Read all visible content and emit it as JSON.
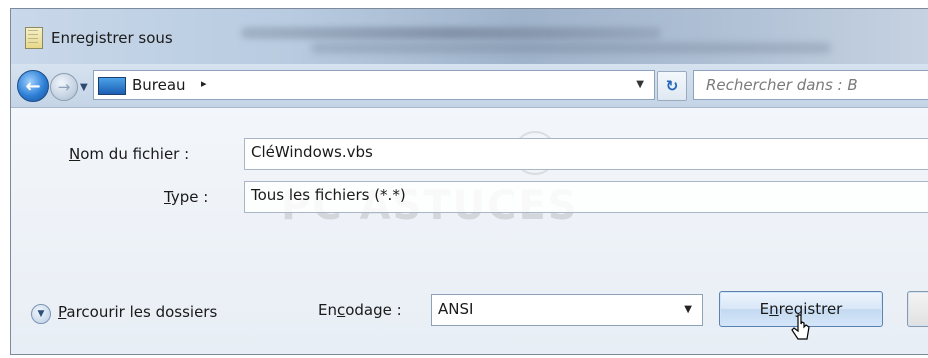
{
  "window": {
    "title": "Enregistrer sous"
  },
  "toolbar": {
    "address_location": "Bureau",
    "address_arrow": "▸",
    "search_placeholder": "Rechercher dans : B"
  },
  "form": {
    "filename_label_hotkey": "N",
    "filename_label_rest": "om du fichier :",
    "filename_value": "CléWindows.vbs",
    "type_label_hotkey": "T",
    "type_label_rest": "ype :",
    "type_value": "Tous les fichiers  (*.*)"
  },
  "footer": {
    "browse_hotkey": "P",
    "browse_rest": "arcourir les dossiers",
    "encoding_label_pre": "En",
    "encoding_label_hotkey": "c",
    "encoding_label_post": "odage :",
    "encoding_value": "ANSI",
    "save_pre": "E",
    "save_hotkey": "n",
    "save_post": "registrer"
  },
  "watermark": "PC ASTUCES",
  "icons": [
    "document-icon",
    "back-arrow-icon",
    "forward-arrow-icon",
    "dropdown-icon",
    "desktop-icon",
    "refresh-icon",
    "expand-circle-icon",
    "mouse-cursor-icon"
  ],
  "colors": {
    "accent": "#2d7fd6",
    "button_border": "#5d82ad",
    "watermark": "#787878"
  }
}
